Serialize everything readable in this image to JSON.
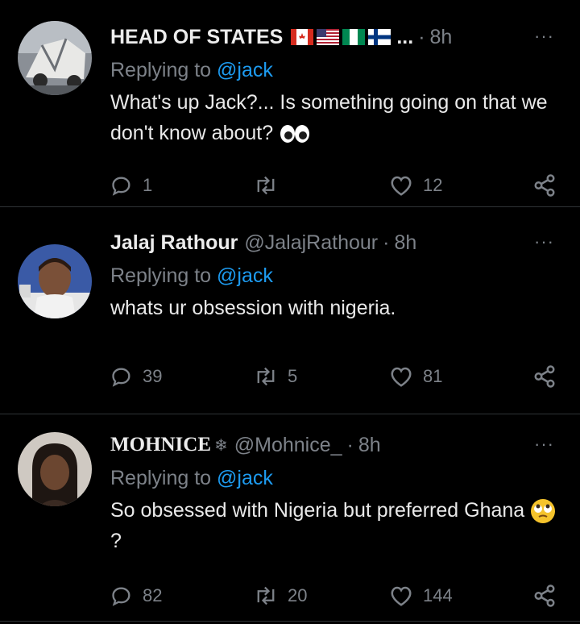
{
  "tweets": [
    {
      "name": "HEAD OF STATES",
      "name_suffix": "...",
      "handle": "",
      "time": "8h",
      "more": "···",
      "reply_prefix": "Replying to",
      "reply_to": "@jack",
      "text": "What's up Jack?... Is something going on that we don't know about?",
      "emoji_name": "eyes-emoji",
      "replies": "1",
      "retweets": "",
      "likes": "12"
    },
    {
      "name": "Jalaj Rathour",
      "handle": "@JalajRathour",
      "time": "8h",
      "more": "···",
      "reply_prefix": "Replying to",
      "reply_to": "@jack",
      "text": "whats ur obsession with nigeria.",
      "replies": "39",
      "retweets": "5",
      "likes": "81"
    },
    {
      "name": "MOHNICE",
      "name_symbol": "❄",
      "handle": "@Mohnice_",
      "time": "8h",
      "more": "···",
      "reply_prefix": "Replying to",
      "reply_to": "@jack",
      "text": "So obsessed with Nigeria but preferred Ghana",
      "text_suffix": "?",
      "emoji_name": "eye-roll-emoji",
      "replies": "82",
      "retweets": "20",
      "likes": "144"
    }
  ],
  "colors": {
    "background": "#000000",
    "mention": "#1d9bf0",
    "muted": "#7d8289",
    "divider": "#2f3336"
  }
}
